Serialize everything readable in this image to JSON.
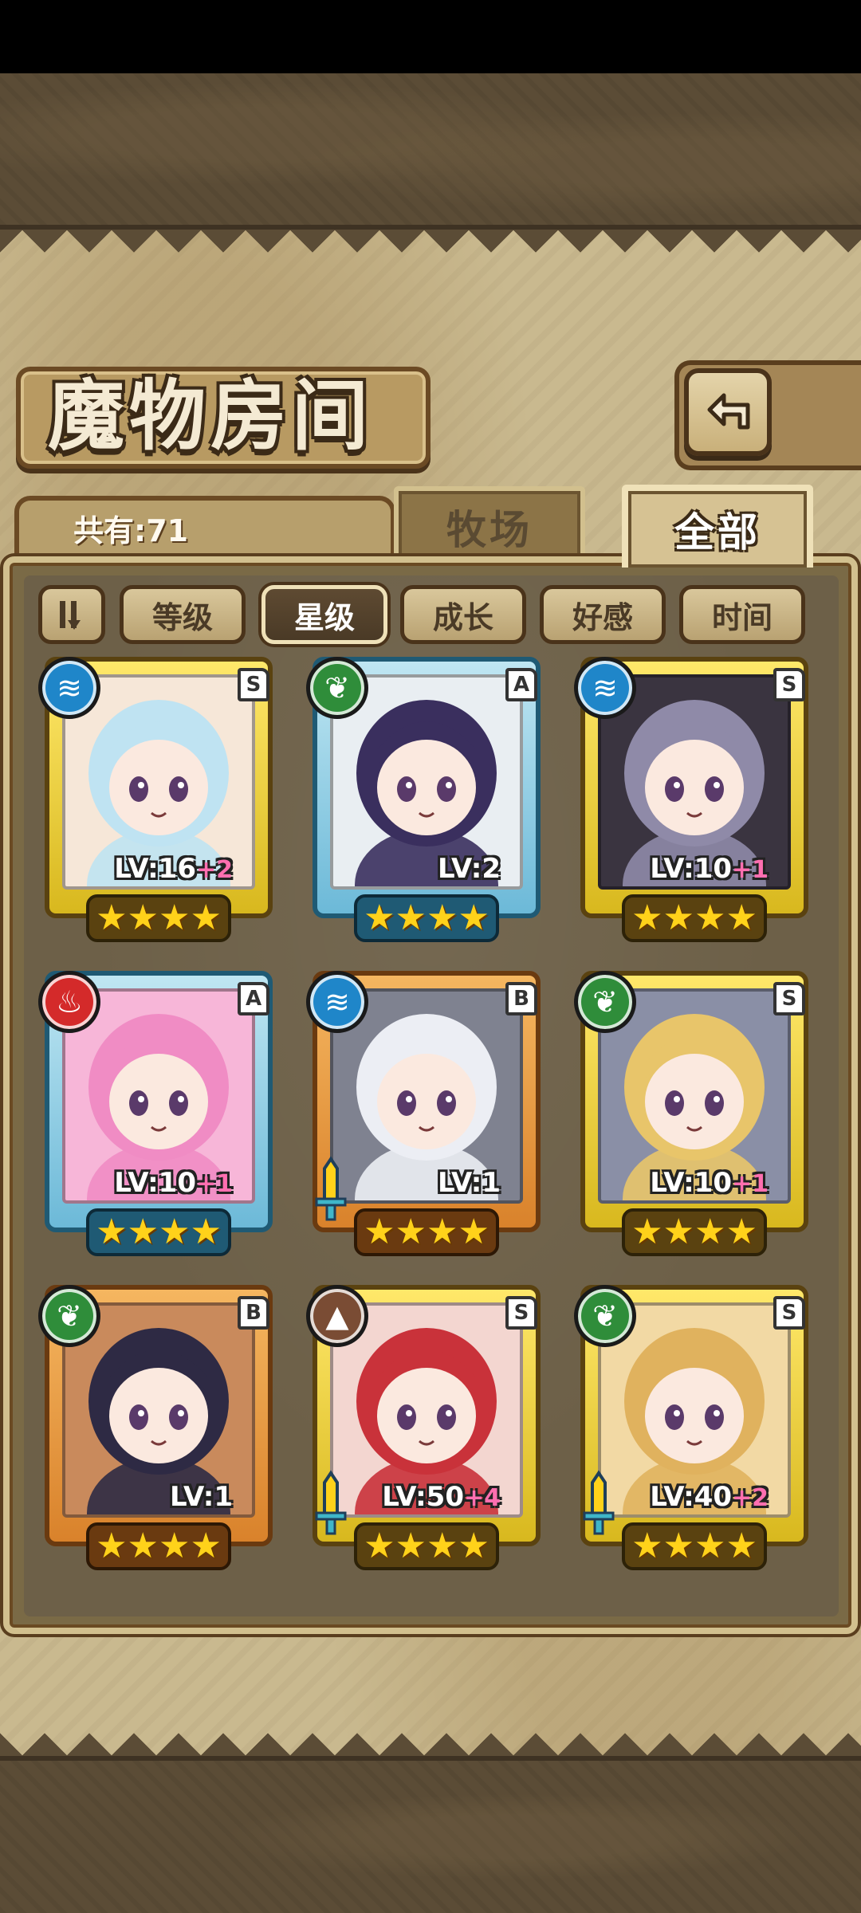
{
  "header": {
    "title": "魔物房间",
    "count_label": "共有:71"
  },
  "tabs": [
    {
      "label": "牧场",
      "active": false
    },
    {
      "label": "全部",
      "active": true
    }
  ],
  "sort": {
    "toggle_icon": "sort-order-icon",
    "buttons": [
      {
        "label": "等级",
        "active": false
      },
      {
        "label": "星级",
        "active": true
      },
      {
        "label": "成长",
        "active": false
      },
      {
        "label": "好感",
        "active": false
      },
      {
        "label": "时间",
        "active": false
      }
    ]
  },
  "monsters": [
    {
      "element": "water",
      "element_icon": "water-element-icon",
      "grade": "S",
      "level": "LV:16",
      "bonus": "+2",
      "stars": "★★★★",
      "weapon": false,
      "hair": "#bfe3f2",
      "bg": "#f6e7d8"
    },
    {
      "element": "wood",
      "element_icon": "wood-element-icon",
      "grade": "A",
      "level": "LV:2",
      "bonus": "",
      "stars": "★★★★",
      "weapon": false,
      "hair": "#3a2f5e",
      "bg": "#e9eef2"
    },
    {
      "element": "water",
      "element_icon": "water-element-icon",
      "grade": "S",
      "level": "LV:10",
      "bonus": "+1",
      "stars": "★★★★",
      "weapon": false,
      "hair": "#8f8aa8",
      "bg": "#3a3440"
    },
    {
      "element": "fire",
      "element_icon": "fire-element-icon",
      "grade": "A",
      "level": "LV:10",
      "bonus": "+1",
      "stars": "★★★★",
      "weapon": false,
      "hair": "#f08cc4",
      "bg": "#f7b6d8"
    },
    {
      "element": "water",
      "element_icon": "water-element-icon",
      "grade": "B",
      "level": "LV:1",
      "bonus": "",
      "stars": "★★★★",
      "weapon": true,
      "hair": "#eceef4",
      "bg": "#7f8290"
    },
    {
      "element": "wood",
      "element_icon": "wood-element-icon",
      "grade": "S",
      "level": "LV:10",
      "bonus": "+1",
      "stars": "★★★★",
      "weapon": false,
      "hair": "#e8c56a",
      "bg": "#8a8fa6"
    },
    {
      "element": "wood",
      "element_icon": "wood-element-icon",
      "grade": "B",
      "level": "LV:1",
      "bonus": "",
      "stars": "★★★★",
      "weapon": false,
      "hair": "#2e2a44",
      "bg": "#c98a5c"
    },
    {
      "element": "earth",
      "element_icon": "earth-element-icon",
      "grade": "S",
      "level": "LV:50",
      "bonus": "+4",
      "stars": "★★★★",
      "weapon": true,
      "hair": "#c9323a",
      "bg": "#f3d6d0"
    },
    {
      "element": "wood",
      "element_icon": "wood-element-icon",
      "grade": "S",
      "level": "LV:40",
      "bonus": "+2",
      "stars": "★★★★",
      "weapon": true,
      "hair": "#e0b25e",
      "bg": "#f2d9a4"
    }
  ]
}
